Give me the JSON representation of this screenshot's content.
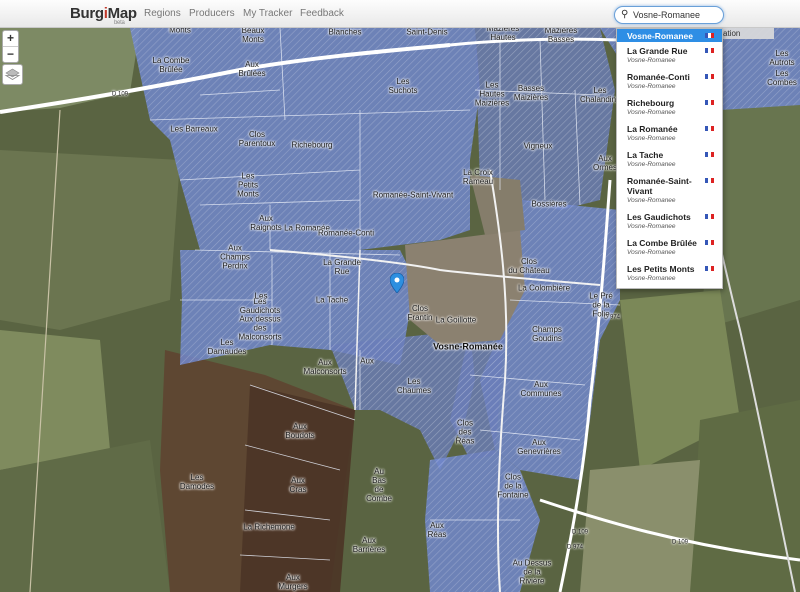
{
  "app": {
    "brand_main": "Burg",
    "brand_accent": "i",
    "brand_end": "Map",
    "brand_sub": "beta"
  },
  "nav": {
    "items": [
      "Regions",
      "Producers",
      "My Tracker",
      "Feedback"
    ]
  },
  "search": {
    "value": "Vosne-Romanee"
  },
  "suggestions": [
    {
      "name": "Vosne-Romanee",
      "sub": ""
    },
    {
      "name": "La Grande Rue",
      "sub": "Vosne-Romanee"
    },
    {
      "name": "Romanée-Conti",
      "sub": "Vosne-Romanee"
    },
    {
      "name": "Richebourg",
      "sub": "Vosne-Romanee"
    },
    {
      "name": "La Romanée",
      "sub": "Vosne-Romanee"
    },
    {
      "name": "La Tache",
      "sub": "Vosne-Romanee"
    },
    {
      "name": "Romanée-Saint-Vivant",
      "sub": "Vosne-Romanee"
    },
    {
      "name": "Les Gaudichots",
      "sub": "Vosne-Romanee"
    },
    {
      "name": "La Combe Brûlée",
      "sub": "Vosne-Romanee"
    },
    {
      "name": "Les Petits Monts",
      "sub": "Vosne-Romanee"
    }
  ],
  "behind_text": "ation",
  "zoom": {
    "in": "+",
    "out": "−"
  },
  "map_labels": [
    "Monts",
    "Beaux\nMonts",
    "Blanches",
    "Saint-Denis",
    "Mazières\nHautes",
    "Mazières\nBasses",
    "La Combe\nBrûlée",
    "Aux\nBrûlées",
    "Les\nSuchots",
    "Les\nHautes\nMaizières",
    "Basses\nMaizières",
    "Les\nChalandins",
    "Les\nAutrots",
    "Les\nCombes",
    "Les Barreaux",
    "Clos\nParentoux",
    "Richebourg",
    "Vigneux",
    "Aux\nOrmes",
    "Les\nPetits\nMonts",
    "La Croix\nRameau",
    "Romanée-Saint-Vivant",
    "Bossières",
    "Aux\nRaignots",
    "La Romanée",
    "Romanée-Conti",
    "Clos\ndu Château",
    "Aux\nChamps\nPerdrix",
    "La Grande\nRue",
    "La Tache",
    "La Colombière",
    "Le Pré\nde la\nFolie",
    "Les\nGaudichots",
    "Clos\nFrantin",
    "La Goillotte",
    "Champs\nGoudins",
    "Aux dessus\ndes\nMalconsorts",
    "Les\nDamaudes",
    "Aux\nMalconsorts",
    "Les\nChaumes",
    "Aux\nCommunes",
    "Aux\nBoudots",
    "Clos\ndes\nRéas",
    "Aux\nGenevrières",
    "Les\nDamodes",
    "Aux\nCras",
    "Au\nBas\nde\nCombe",
    "Clos\nde la\nFontaine",
    "La Richemone",
    "Aux\nRéas",
    "Aux\nBarrières",
    "Au Dessus\nde la\nRivière",
    "Aux\nMurgers",
    "Les",
    "Aux"
  ],
  "village_label": "Vosne-Romanée",
  "road_labels": [
    "D 109",
    "D 974",
    "D 109",
    "D 974",
    "D 109"
  ],
  "colors": {
    "appellation_fill": "#7b92d6",
    "premier_cru_fill": "#5e77c8",
    "other_commune_fill": "#6b4a35",
    "accent": "#2e8ee5"
  }
}
